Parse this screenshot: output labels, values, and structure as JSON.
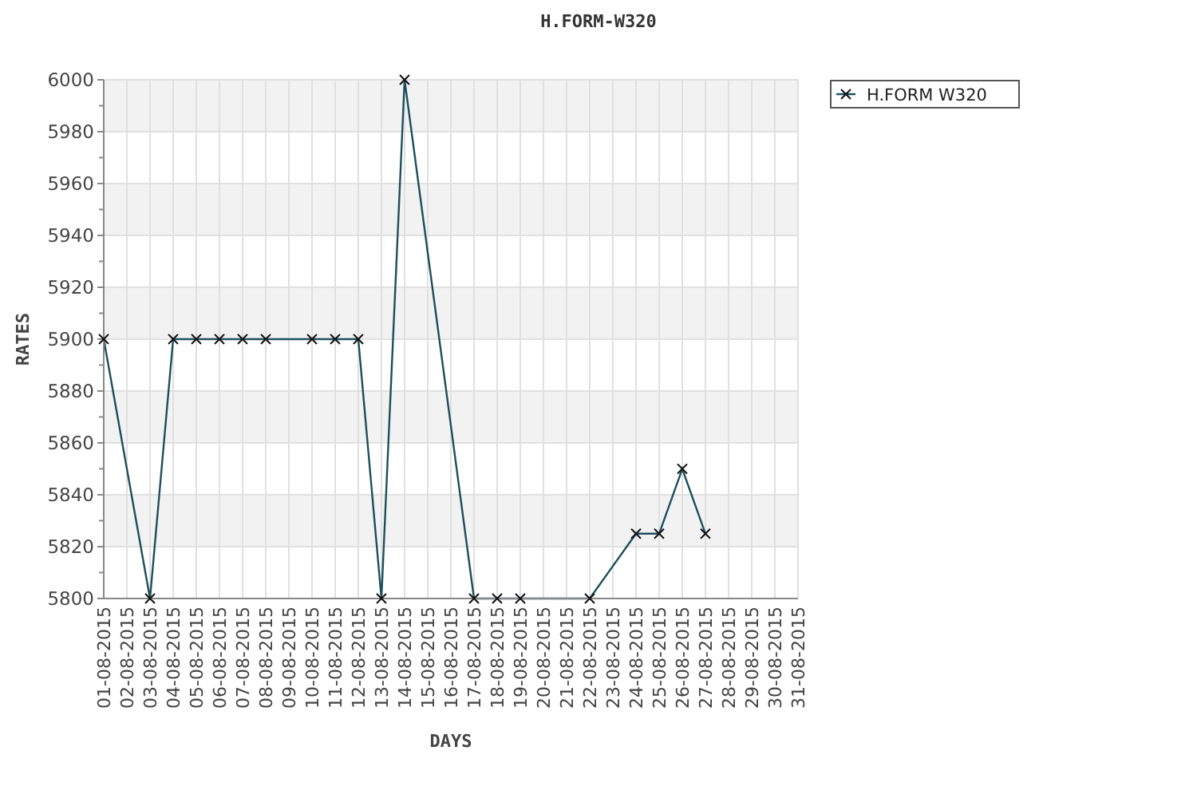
{
  "chart_data": {
    "type": "line",
    "title": "H.FORM-W320",
    "xlabel": "DAYS",
    "ylabel": "RATES",
    "categories": [
      "01-08-2015",
      "02-08-2015",
      "03-08-2015",
      "04-08-2015",
      "05-08-2015",
      "06-08-2015",
      "07-08-2015",
      "08-08-2015",
      "09-08-2015",
      "10-08-2015",
      "11-08-2015",
      "12-08-2015",
      "13-08-2015",
      "14-08-2015",
      "15-08-2015",
      "16-08-2015",
      "17-08-2015",
      "18-08-2015",
      "19-08-2015",
      "20-08-2015",
      "21-08-2015",
      "22-08-2015",
      "23-08-2015",
      "24-08-2015",
      "25-08-2015",
      "26-08-2015",
      "27-08-2015",
      "28-08-2015",
      "29-08-2015",
      "30-08-2015",
      "31-08-2015"
    ],
    "grid": true,
    "series": [
      {
        "name": "H.FORM W320",
        "color": "#1b4f5c",
        "marker": "x",
        "values": [
          5900,
          null,
          5800,
          5900,
          5900,
          5900,
          5900,
          5900,
          null,
          5900,
          5900,
          5900,
          5800,
          6000,
          null,
          null,
          5800,
          5800,
          5800,
          null,
          null,
          5800,
          null,
          5825,
          5825,
          5850,
          5825,
          null,
          null,
          null,
          null
        ]
      }
    ],
    "ylim": [
      5800,
      6000
    ],
    "yticks": [
      5800,
      5820,
      5840,
      5860,
      5880,
      5900,
      5920,
      5940,
      5960,
      5980,
      6000
    ]
  }
}
